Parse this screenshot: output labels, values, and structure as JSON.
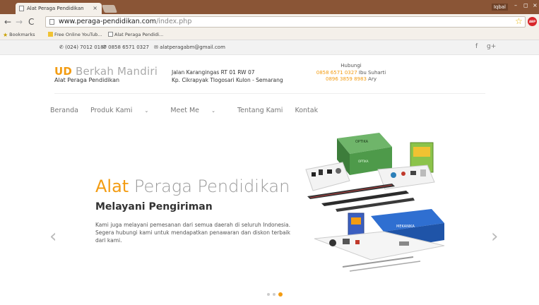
{
  "browser": {
    "tab_title": "Alat Peraga Pendidikan",
    "tab_close": "×",
    "user": "Iqbal",
    "url_domain": "www.peraga-pendidikan.com",
    "url_path": "/index.php",
    "bookmarks": [
      {
        "label": "Bookmarks",
        "icon": "star-icon"
      },
      {
        "label": "Free Online YouTub...",
        "icon": "folder-icon"
      },
      {
        "label": "Alat Peraga Pendidi...",
        "icon": "page-icon"
      }
    ]
  },
  "topbar": {
    "phone1": "(024) 7012 0187",
    "phone2": "0858 6571 0327",
    "email": "alatperagabm@gmail.com",
    "social": [
      "f",
      "g+"
    ]
  },
  "header": {
    "brand_prefix": "UD",
    "brand_name": "Berkah Mandiri",
    "brand_sub": "Alat Peraga Pendidikan",
    "address_line1": "Jalan Karangingas RT 01 RW 07",
    "address_line2": "Kp. Cikrapyak Tlogosari Kulon - Semarang",
    "contact_heading": "Hubungi",
    "contact1_phone": "0858 6571 0327",
    "contact1_name": "Ibu Suharti",
    "contact2_phone": "0896 3859 8983",
    "contact2_name": "Ary"
  },
  "nav": {
    "items": [
      {
        "label": "Beranda"
      },
      {
        "label": "Produk Kami"
      },
      {
        "label": "Meet Me"
      },
      {
        "label": "Tentang Kami"
      },
      {
        "label": "Kontak"
      }
    ]
  },
  "hero": {
    "title_highlight": "Alat",
    "title_rest": "Peraga Pendidikan",
    "subtitle": "Melayani Pengiriman",
    "description": "Kami juga melayani pemesanan dari semua daerah di seluruh Indonesia. Segera hubungi kami untuk mendapatkan penawaran dan diskon terbaik dari kami.",
    "prev": "‹",
    "next": "›",
    "box1_label": "OPTIKA",
    "box1_label2": "OPTIKA",
    "box2_label": "MEKANIKA",
    "slide_count": 3,
    "active_slide": 3
  }
}
